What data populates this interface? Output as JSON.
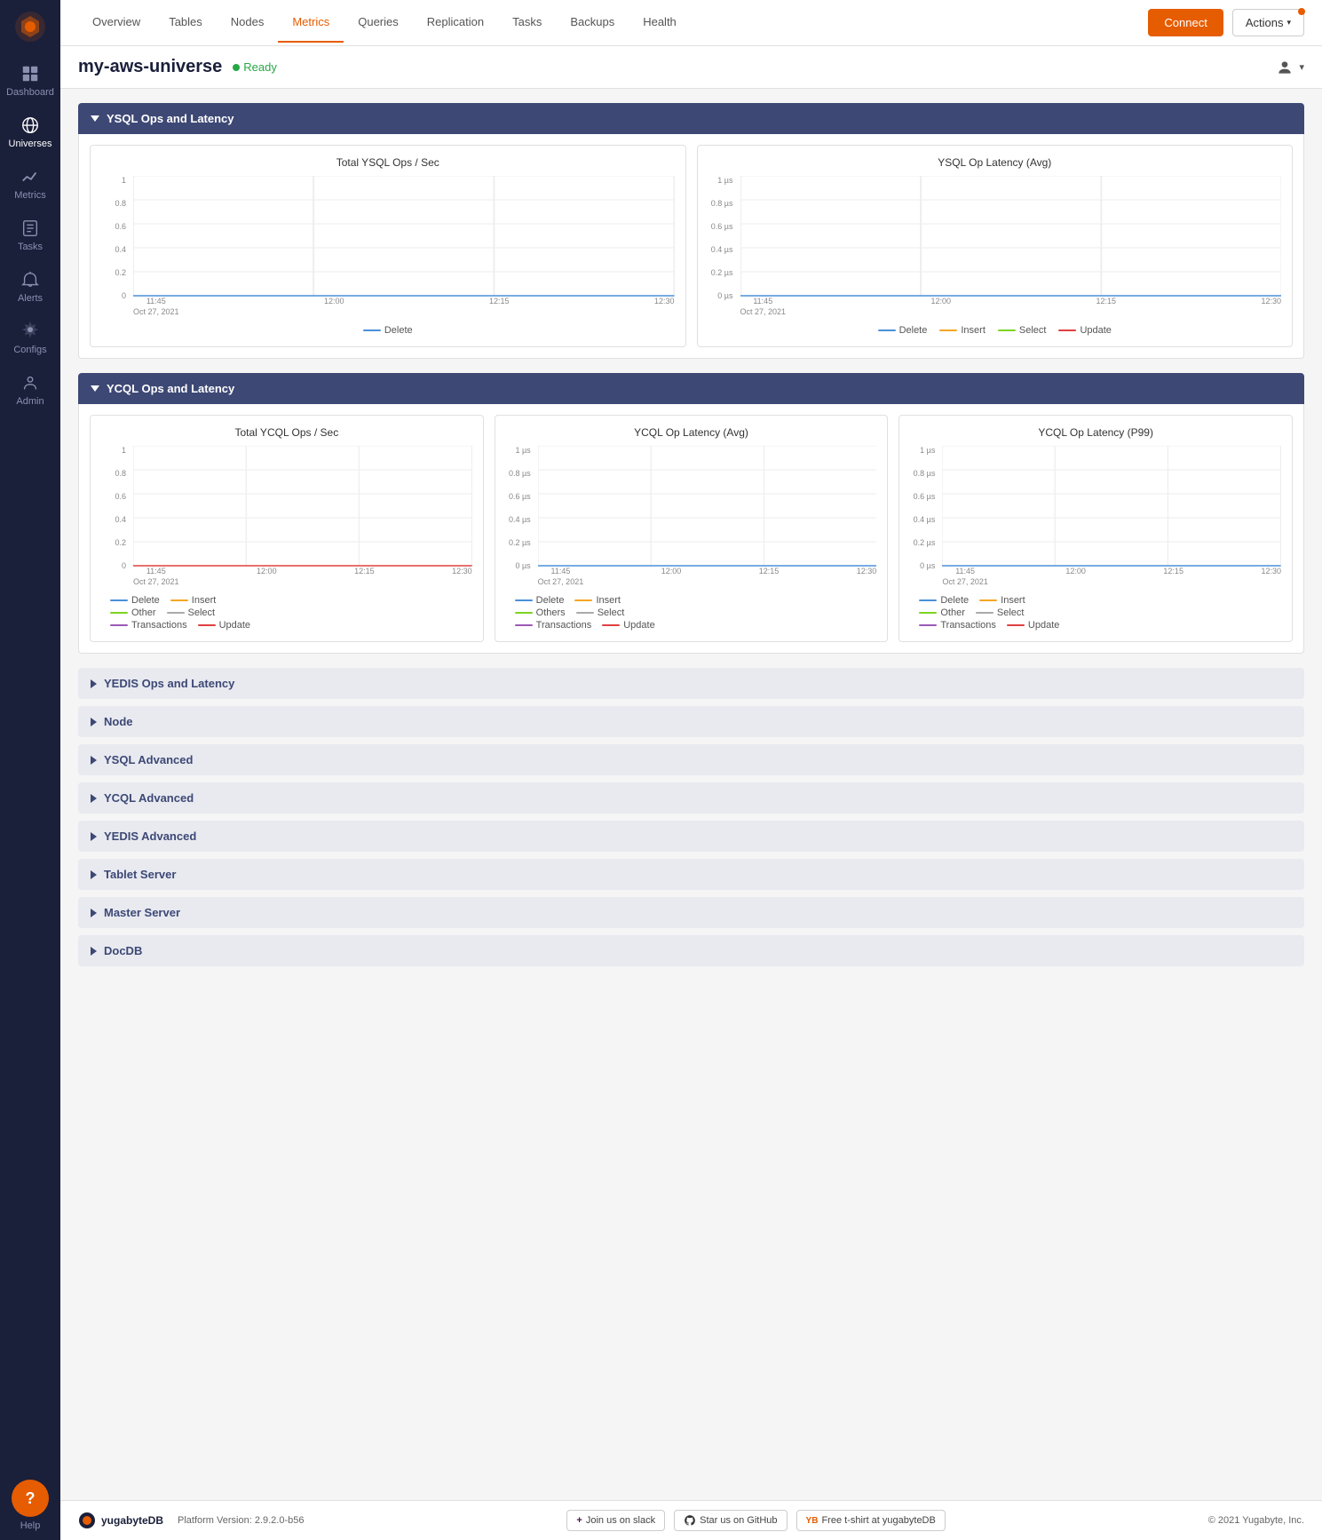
{
  "app": {
    "title": "yugabyteDB"
  },
  "sidebar": {
    "items": [
      {
        "id": "dashboard",
        "label": "Dashboard",
        "icon": "dashboard"
      },
      {
        "id": "universes",
        "label": "Universes",
        "icon": "universes",
        "active": true
      },
      {
        "id": "metrics",
        "label": "Metrics",
        "icon": "metrics"
      },
      {
        "id": "tasks",
        "label": "Tasks",
        "icon": "tasks"
      },
      {
        "id": "alerts",
        "label": "Alerts",
        "icon": "alerts"
      },
      {
        "id": "configs",
        "label": "Configs",
        "icon": "configs"
      },
      {
        "id": "admin",
        "label": "Admin",
        "icon": "admin"
      }
    ],
    "help_label": "Help"
  },
  "topnav": {
    "tabs": [
      {
        "id": "overview",
        "label": "Overview"
      },
      {
        "id": "tables",
        "label": "Tables"
      },
      {
        "id": "nodes",
        "label": "Nodes"
      },
      {
        "id": "metrics",
        "label": "Metrics",
        "active": true
      },
      {
        "id": "queries",
        "label": "Queries"
      },
      {
        "id": "replication",
        "label": "Replication"
      },
      {
        "id": "tasks",
        "label": "Tasks"
      },
      {
        "id": "backups",
        "label": "Backups"
      },
      {
        "id": "health",
        "label": "Health"
      }
    ],
    "connect_label": "Connect",
    "actions_label": "Actions"
  },
  "universe": {
    "name": "my-aws-universe",
    "status": "Ready",
    "status_color": "#28a745"
  },
  "sections": {
    "ysql": {
      "title": "YSQL Ops and Latency",
      "expanded": true,
      "charts": [
        {
          "id": "ysql-ops",
          "title": "Total YSQL Ops / Sec",
          "y_labels": [
            "1",
            "0.8",
            "0.6",
            "0.4",
            "0.2",
            "0"
          ],
          "x_labels": [
            {
              "time": "11:45",
              "date": "Oct 27, 2021"
            },
            {
              "time": "12:00",
              "date": ""
            },
            {
              "time": "12:15",
              "date": ""
            },
            {
              "time": "12:30",
              "date": ""
            }
          ],
          "legend": [
            {
              "label": "Delete",
              "color": "#4a90d9"
            }
          ]
        },
        {
          "id": "ysql-latency",
          "title": "YSQL Op Latency (Avg)",
          "y_labels": [
            "1 µs",
            "0.8 µs",
            "0.6 µs",
            "0.4 µs",
            "0.2 µs",
            "0 µs"
          ],
          "x_labels": [
            {
              "time": "11:45",
              "date": "Oct 27, 2021"
            },
            {
              "time": "12:00",
              "date": ""
            },
            {
              "time": "12:15",
              "date": ""
            },
            {
              "time": "12:30",
              "date": ""
            }
          ],
          "legend": [
            {
              "label": "Delete",
              "color": "#4a90d9"
            },
            {
              "label": "Insert",
              "color": "#f5a623"
            },
            {
              "label": "Select",
              "color": "#7ed321"
            },
            {
              "label": "Update",
              "color": "#e04040"
            }
          ]
        }
      ]
    },
    "ycql": {
      "title": "YCQL Ops and Latency",
      "expanded": true,
      "charts": [
        {
          "id": "ycql-ops",
          "title": "Total YCQL Ops / Sec",
          "y_labels": [
            "1",
            "0.8",
            "0.6",
            "0.4",
            "0.2",
            "0"
          ],
          "x_labels": [
            {
              "time": "11:45",
              "date": "Oct 27, 2021"
            },
            {
              "time": "12:00",
              "date": ""
            },
            {
              "time": "12:15",
              "date": ""
            },
            {
              "time": "12:30",
              "date": ""
            }
          ],
          "legend": [
            {
              "label": "Delete",
              "color": "#4a90d9"
            },
            {
              "label": "Insert",
              "color": "#f5a623"
            },
            {
              "label": "Other",
              "color": "#7ed321"
            },
            {
              "label": "Select",
              "color": "#7ed321"
            },
            {
              "label": "Transactions",
              "color": "#9b59b6"
            },
            {
              "label": "Update",
              "color": "#e04040"
            }
          ]
        },
        {
          "id": "ycql-latency-avg",
          "title": "YCQL Op Latency (Avg)",
          "y_labels": [
            "1 µs",
            "0.8 µs",
            "0.6 µs",
            "0.4 µs",
            "0.2 µs",
            "0 µs"
          ],
          "x_labels": [
            {
              "time": "11:45",
              "date": "Oct 27, 2021"
            },
            {
              "time": "12:00",
              "date": ""
            },
            {
              "time": "12:15",
              "date": ""
            },
            {
              "time": "12:30",
              "date": ""
            }
          ],
          "legend": [
            {
              "label": "Delete",
              "color": "#4a90d9"
            },
            {
              "label": "Insert",
              "color": "#f5a623"
            },
            {
              "label": "Others",
              "color": "#7ed321"
            },
            {
              "label": "Select",
              "color": "#7ed321"
            },
            {
              "label": "Transactions",
              "color": "#9b59b6"
            },
            {
              "label": "Update",
              "color": "#e04040"
            }
          ]
        },
        {
          "id": "ycql-latency-p99",
          "title": "YCQL Op Latency (P99)",
          "y_labels": [
            "1 µs",
            "0.8 µs",
            "0.6 µs",
            "0.4 µs",
            "0.2 µs",
            "0 µs"
          ],
          "x_labels": [
            {
              "time": "11:45",
              "date": "Oct 27, 2021"
            },
            {
              "time": "12:00",
              "date": ""
            },
            {
              "time": "12:15",
              "date": ""
            },
            {
              "time": "12:30",
              "date": ""
            }
          ],
          "legend": [
            {
              "label": "Delete",
              "color": "#4a90d9"
            },
            {
              "label": "Insert",
              "color": "#f5a623"
            },
            {
              "label": "Other",
              "color": "#7ed321"
            },
            {
              "label": "Select",
              "color": "#7ed321"
            },
            {
              "label": "Transactions",
              "color": "#9b59b6"
            },
            {
              "label": "Update",
              "color": "#e04040"
            }
          ]
        }
      ]
    },
    "collapsed": [
      {
        "id": "yedis",
        "label": "YEDIS Ops and Latency"
      },
      {
        "id": "node",
        "label": "Node"
      },
      {
        "id": "ysql-advanced",
        "label": "YSQL Advanced"
      },
      {
        "id": "ycql-advanced",
        "label": "YCQL Advanced"
      },
      {
        "id": "yedis-advanced",
        "label": "YEDIS Advanced"
      },
      {
        "id": "tablet-server",
        "label": "Tablet Server"
      },
      {
        "id": "master-server",
        "label": "Master Server"
      },
      {
        "id": "docdb",
        "label": "DocDB"
      }
    ]
  },
  "footer": {
    "brand": "yugabyteDB",
    "version_label": "Platform Version: 2.9.2.0-b56",
    "slack_label": "Join us on  slack",
    "github_label": "Star us on  GitHub",
    "tshirt_label": "Free t-shirt at  yugabyteDB",
    "copyright": "© 2021 Yugabyte, Inc."
  }
}
